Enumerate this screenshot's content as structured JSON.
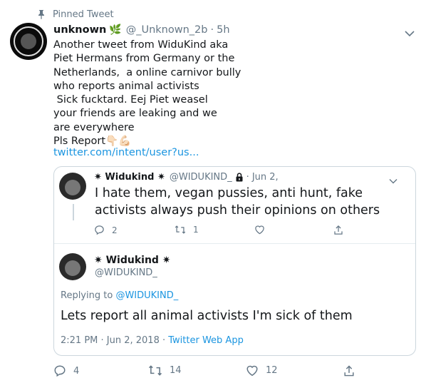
{
  "pinned": {
    "label": "Pinned Tweet"
  },
  "tweet": {
    "display_name": "unknown",
    "name_emoji": "🌿",
    "handle": "@_Unknown_2b",
    "separator": "·",
    "time": "5h",
    "text": "Another tweet from WiduKind aka\nPiet Hermans from Germany or the\nNetherlands,  a online carnivor bully\nwho reports animal activists\n Sick fucktard. Eej Piet weasel\nyour friends are leaking and we\nare everywhere\nPls Report👇🏻💪🏻",
    "link": "twitter.com/intent/user?us...",
    "actions": {
      "replies": "4",
      "retweets": "14",
      "likes": "12"
    }
  },
  "quoted": {
    "display_name": "✷ Widukind ✷",
    "handle": "@WIDUKIND_",
    "separator": "·",
    "time": "Jun 2,",
    "text": "I hate them, vegan pussies, anti hunt, fake activists always push their opinions on others",
    "actions": {
      "replies": "2",
      "retweets": "1"
    }
  },
  "reply": {
    "display_name": "✷ Widukind ✷",
    "handle": "@WIDUKIND_",
    "replying_prefix": "Replying to ",
    "replying_to": "@WIDUKIND_",
    "text": "Lets report all animal activists I'm sick of them",
    "timestamp": "2:21 PM · Jun 2, 2018 · ",
    "app": "Twitter Web App"
  },
  "icons": {
    "pin": "pin-icon",
    "chevron": "chevron-down-icon",
    "lock": "lock-icon",
    "reply": "reply-icon",
    "retweet": "retweet-icon",
    "like": "heart-icon",
    "share": "share-icon"
  },
  "colors": {
    "link": "#1b95e0",
    "muted": "#657786",
    "text": "#14171a",
    "border": "#ccd6dd"
  }
}
